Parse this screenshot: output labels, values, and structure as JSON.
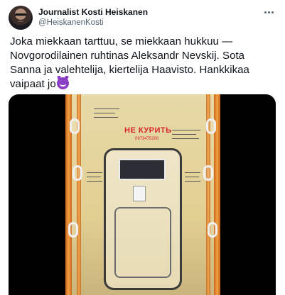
{
  "author": {
    "name": "Journalist Kosti Heiskanen",
    "handle": "@HeiskanenKosti",
    "avatar_icon": "profile-avatar"
  },
  "menu_icon": "more-options-icon",
  "tweet": {
    "text": "Joka miekkaan tarttuu, se miekkaan hukkuu — Novgorodilainen ruhtinas Aleksandr Nevskij. Sota Sanna ja valehtelija, kiertelija Haavisto. Hankkikaa vaipaat jo",
    "emoji": "smiling-imp-emoji"
  },
  "media": {
    "type": "video",
    "sign_text": "НЕ КУРИТЬ",
    "sign_number": "0973475200",
    "colors": {
      "wall": "#e2cf92",
      "rails": "#f2a043",
      "sign": "#d6262d"
    }
  }
}
